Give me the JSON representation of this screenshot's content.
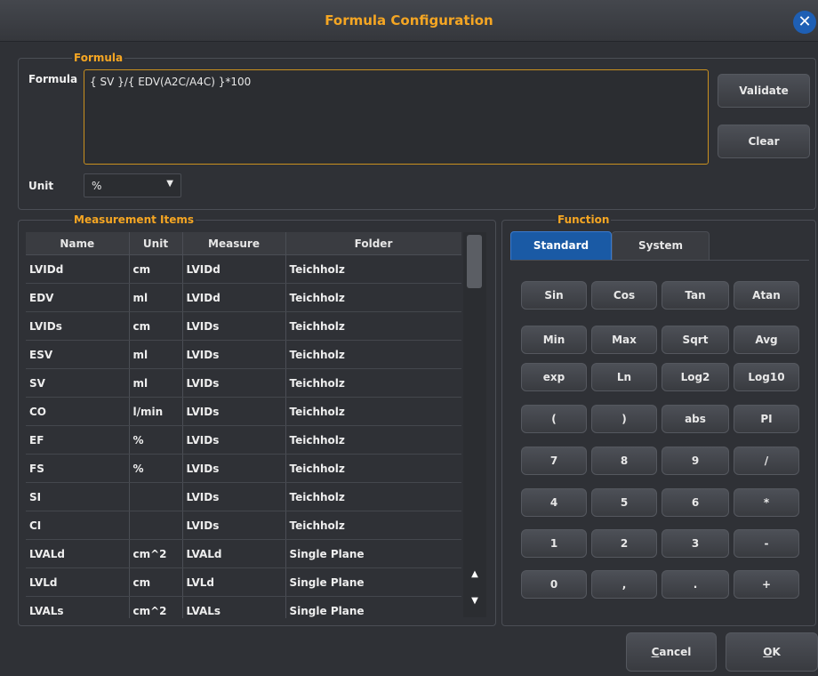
{
  "window": {
    "title": "Formula Configuration",
    "close_glyph": "✕"
  },
  "formula": {
    "group_title": "Formula",
    "label": "Formula",
    "value": "{ SV }/{ EDV(A2C/A4C) }*100",
    "validate_label": "Validate",
    "clear_label": "Clear",
    "unit_label": "Unit",
    "unit_value": "%"
  },
  "measurement": {
    "group_title": "Measurement Items",
    "columns": [
      "Name",
      "Unit",
      "Measure",
      "Folder"
    ],
    "rows": [
      [
        "LVIDd",
        "cm",
        "LVIDd",
        "Teichholz"
      ],
      [
        "EDV",
        "ml",
        "LVIDd",
        "Teichholz"
      ],
      [
        "LVIDs",
        "cm",
        "LVIDs",
        "Teichholz"
      ],
      [
        "ESV",
        "ml",
        "LVIDs",
        "Teichholz"
      ],
      [
        "SV",
        "ml",
        "LVIDs",
        "Teichholz"
      ],
      [
        "CO",
        "l/min",
        "LVIDs",
        "Teichholz"
      ],
      [
        "EF",
        "%",
        "LVIDs",
        "Teichholz"
      ],
      [
        "FS",
        "%",
        "LVIDs",
        "Teichholz"
      ],
      [
        "SI",
        "",
        "LVIDs",
        "Teichholz"
      ],
      [
        "CI",
        "",
        "LVIDs",
        "Teichholz"
      ],
      [
        "LVALd",
        "cm^2",
        "LVALd",
        "Single Plane"
      ],
      [
        "LVLd",
        "cm",
        "LVLd",
        "Single Plane"
      ],
      [
        "LVALs",
        "cm^2",
        "LVALs",
        "Single Plane"
      ]
    ]
  },
  "function": {
    "group_title": "Function",
    "tabs": [
      "Standard",
      "System"
    ],
    "keys": [
      [
        "Sin",
        "Cos",
        "Tan",
        "Atan"
      ],
      [
        "Min",
        "Max",
        "Sqrt",
        "Avg"
      ],
      [
        "exp",
        "Ln",
        "Log2",
        "Log10"
      ],
      [
        "(",
        ")",
        "abs",
        "PI"
      ],
      [
        "7",
        "8",
        "9",
        "/"
      ],
      [
        "4",
        "5",
        "6",
        "*"
      ],
      [
        "1",
        "2",
        "3",
        "-"
      ],
      [
        "0",
        ",",
        ".",
        "+"
      ]
    ]
  },
  "footer": {
    "cancel_label": "Cancel",
    "ok_label": "OK"
  },
  "colors": {
    "accent": "#f5a623",
    "tab_active": "#1a5aa5",
    "background": "#2f3136"
  }
}
